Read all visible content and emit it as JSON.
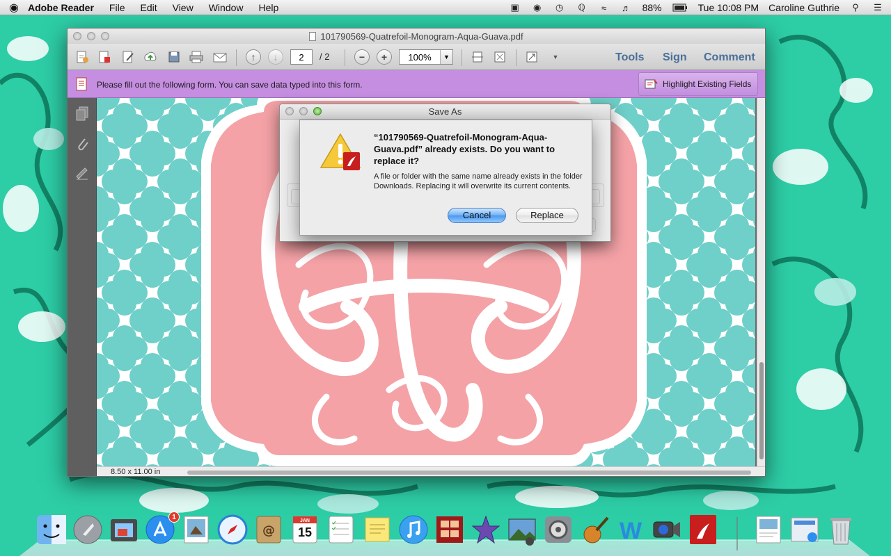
{
  "menubar": {
    "apple": "",
    "app_name": "Adobe Reader",
    "menus": [
      "File",
      "Edit",
      "View",
      "Window",
      "Help"
    ],
    "battery": "88%",
    "clock": "Tue 10:08 PM",
    "user": "Caroline Guthrie",
    "status_icons": [
      "drive-icon",
      "activity-icon",
      "time-machine-icon",
      "bluetooth-icon",
      "wifi-icon",
      "volume-icon",
      "battery-icon"
    ]
  },
  "window": {
    "title": "101790569-Quatrefoil-Monogram-Aqua-Guava.pdf",
    "toolbar": {
      "page_value": "2",
      "page_total": "/  2",
      "zoom": "100%",
      "links": [
        "Tools",
        "Sign",
        "Comment"
      ]
    },
    "form_bar": {
      "message": "Please fill out the following form. You can save data typed into this form.",
      "highlight_label": "Highlight Existing Fields"
    },
    "status": {
      "page_size": "8.50 x 11.00 in"
    }
  },
  "save_sheet": {
    "title": "Save As"
  },
  "alert": {
    "title": "“101790569-Quatrefoil-Monogram-Aqua-Guava.pdf” already exists. Do you want to replace it?",
    "message": "A file or folder with the same name already exists in the folder Downloads. Replacing it will overwrite its current contents.",
    "cancel_label": "Cancel",
    "replace_label": "Replace"
  },
  "dock": {
    "app_store_badge": "1",
    "calendar_day": "15",
    "calendar_month": "JAN",
    "apps": [
      "Finder",
      "Launchpad",
      "Image Capture",
      "App Store",
      "Preview",
      "Safari",
      "Contacts",
      "Calendar",
      "Reminders",
      "Stickies",
      "iTunes",
      "Photo Booth",
      "iMovie",
      "iPhoto",
      "System Preferences",
      "GarageBand",
      "Word",
      "FaceTime",
      "Adobe Reader"
    ]
  },
  "colors": {
    "wallpaper": "#2fcfa8",
    "form_bar": "#c58ee0",
    "quatrefoil_teal": "#6fcfc9",
    "monogram_pink": "#f4a2a6",
    "link_blue": "#4a6f99"
  }
}
